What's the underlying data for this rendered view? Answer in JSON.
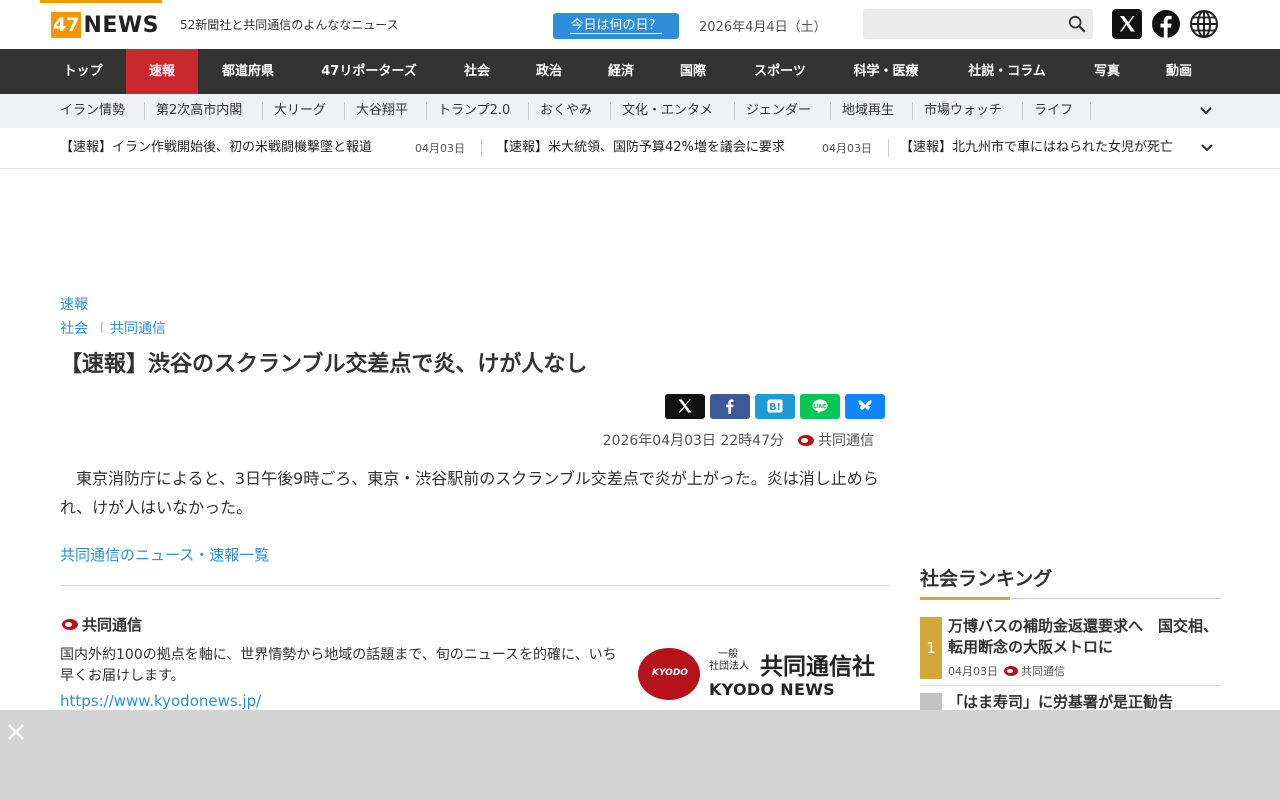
{
  "header": {
    "logo_number": "47",
    "logo_word": "NEWS",
    "tagline": "52新聞社と共同通信のよんななニュース",
    "today_button": "今日は何の日？",
    "date": "2026年4月4日（土）",
    "search_placeholder": ""
  },
  "main_nav": [
    {
      "label": "トップ"
    },
    {
      "label": "速報",
      "active": true
    },
    {
      "label": "都道府県"
    },
    {
      "label": "47リポーターズ"
    },
    {
      "label": "社会"
    },
    {
      "label": "政治"
    },
    {
      "label": "経済"
    },
    {
      "label": "国際"
    },
    {
      "label": "スポーツ"
    },
    {
      "label": "科学・医療"
    },
    {
      "label": "社説・コラム"
    },
    {
      "label": "写真"
    },
    {
      "label": "動画"
    }
  ],
  "sub_nav": [
    {
      "label": "イラン情勢"
    },
    {
      "label": "第2次高市内閣"
    },
    {
      "label": "大リーグ"
    },
    {
      "label": "大谷翔平"
    },
    {
      "label": "トランプ2.0"
    },
    {
      "label": "おくやみ"
    },
    {
      "label": "文化・エンタメ"
    },
    {
      "label": "ジェンダー"
    },
    {
      "label": "地域再生"
    },
    {
      "label": "市場ウォッチ"
    },
    {
      "label": "ライフ"
    }
  ],
  "ticker": [
    {
      "text": "【速報】イラン作戦開始後、初の米戦闘機撃墜と報道",
      "date": "04月03日"
    },
    {
      "text": "【速報】米大統領、国防予算42%増を議会に要求",
      "date": "04月03日"
    },
    {
      "text": "【速報】北九州市で車にはねられた女児が死亡",
      "date": ""
    }
  ],
  "article": {
    "category": "速報",
    "breadcrumb": [
      "社会",
      "共同通信"
    ],
    "title": "【速報】渋谷のスクランブル交差点で炎、けが人なし",
    "datetime": "2026年04月03日 22時47分",
    "source": "共同通信",
    "body": "　東京消防庁によると、3日午後9時ごろ、東京・渋谷駅前のスクランブル交差点で炎が上がった。炎は消し止められ、けが人はいなかった。",
    "list_link": "共同通信のニュース・速報一覧"
  },
  "source_box": {
    "name": "共同通信",
    "description": "国内外約100の拠点を軸に、世界情勢から地域の話題まで、旬のニュースを的確に、いち早くお届けします。",
    "url": "https://www.kyodonews.jp/",
    "logo_circle": "KYODO",
    "logo_small_1": "一般",
    "logo_small_2": "社団法人",
    "logo_big": "共同通信社",
    "logo_en": "KYODO NEWS"
  },
  "ranking": {
    "title": "社会ランキング",
    "items": [
      {
        "rank": "1",
        "title": "万博バスの補助金返還要求へ　国交相、転用断念の大阪メトロに",
        "date": "04月03日",
        "source": "共同通信"
      },
      {
        "rank": "",
        "title": "「はま寿司」に労基署が是正勧告"
      }
    ]
  },
  "colors": {
    "accent_orange": "#f39800",
    "nav_dark": "#333333",
    "nav_active": "#c8282d",
    "link_blue": "#2d8fd9",
    "rank_gold": "#d4a73a",
    "kyodo_red": "#b5121b"
  }
}
